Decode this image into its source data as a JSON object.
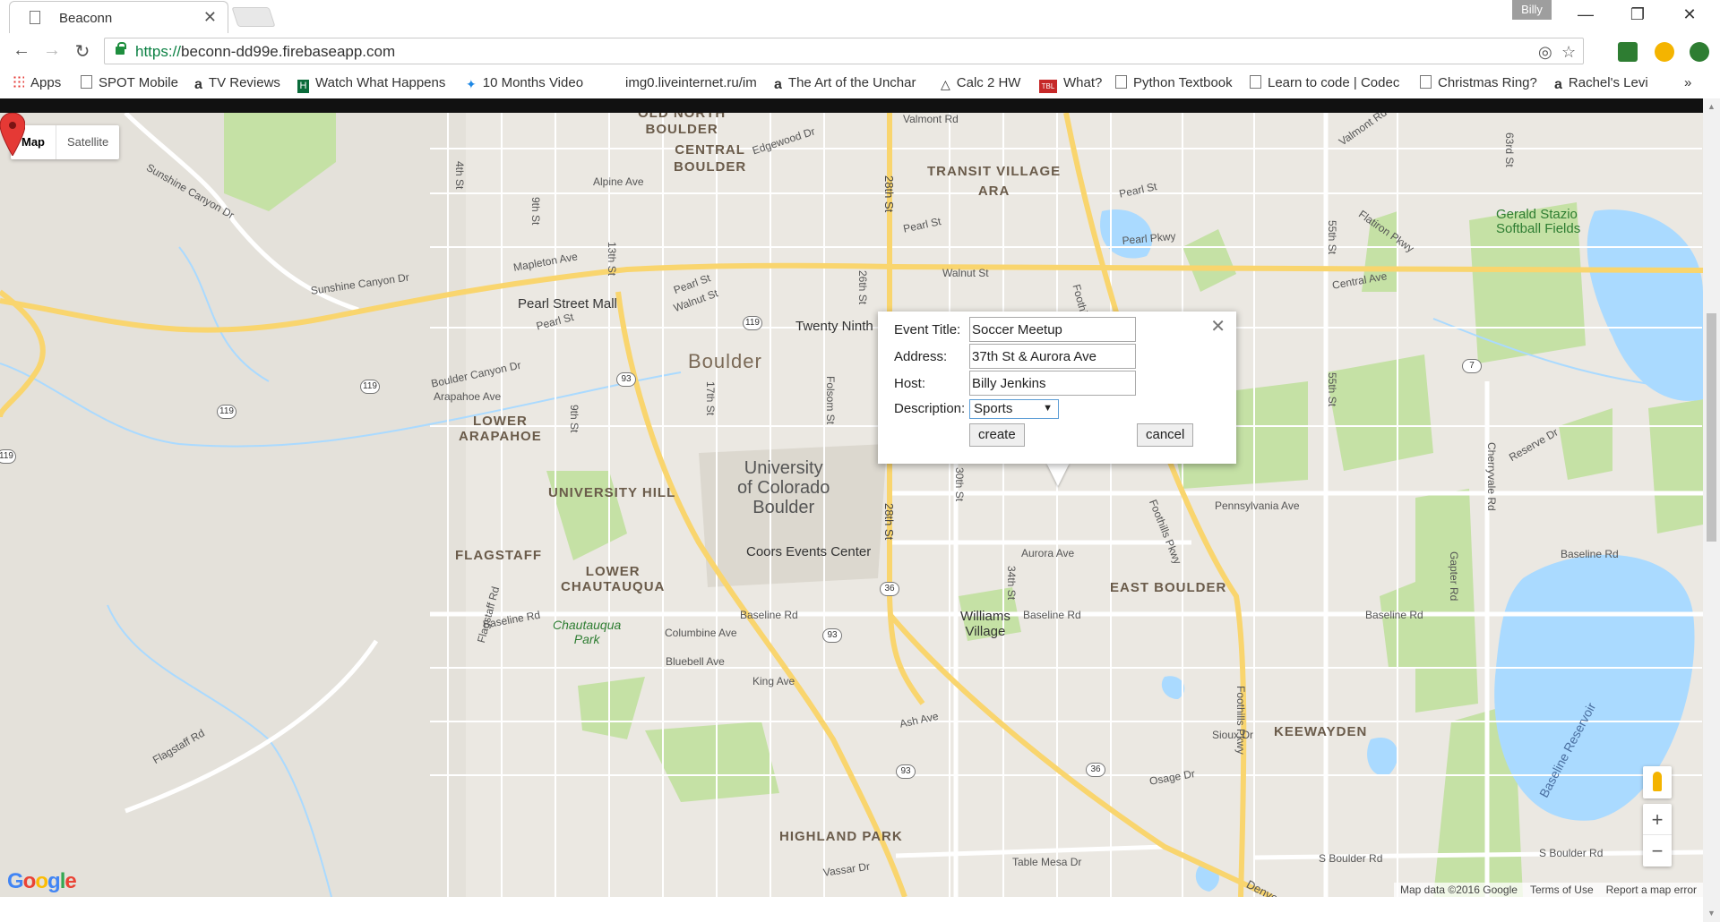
{
  "browser": {
    "tab_title": "Beaconn",
    "profile_name": "Billy",
    "url_scheme": "https://",
    "url_host": "beconn-dd99e.firebaseapp.com",
    "minimize_glyph": "—",
    "restore_glyph": "❐",
    "close_glyph": "✕",
    "back_glyph": "←",
    "forward_glyph": "→",
    "reload_glyph": "↻",
    "star_glyph": "☆",
    "target_glyph": "◎",
    "bookmarks_more": "»",
    "bookmarks": [
      {
        "label": "Apps",
        "icon": "apps-grid-icon"
      },
      {
        "label": "SPOT Mobile",
        "icon": "page-icon"
      },
      {
        "label": "TV Reviews",
        "icon": "amazon-icon"
      },
      {
        "label": "Watch What Happens",
        "icon": "h-icon"
      },
      {
        "label": "10 Months Video",
        "icon": "dropbox-icon"
      },
      {
        "label": "img0.liveinternet.ru/im",
        "icon": "none"
      },
      {
        "label": "The Art of the Unchar",
        "icon": "amazon-icon"
      },
      {
        "label": "Calc 2 HW",
        "icon": "calc-icon"
      },
      {
        "label": "What?",
        "icon": "tbl-icon"
      },
      {
        "label": "Python Textbook",
        "icon": "page-icon"
      },
      {
        "label": "Learn to code | Codec",
        "icon": "codecademy-icon"
      },
      {
        "label": "Christmas Ring?",
        "icon": "image-icon"
      },
      {
        "label": "Rachel's Levi",
        "icon": "amazon-icon"
      }
    ]
  },
  "map": {
    "type_map": "Map",
    "type_satellite": "Satellite",
    "google_logo": "Google",
    "attribution": [
      "Map data ©2016 Google",
      "Terms of Use",
      "Report a map error"
    ],
    "zoom_in": "+",
    "zoom_out": "−",
    "labels": {
      "central_boulder": "CENTRAL\nBOULDER",
      "old_north_boulder": "OLD NORTH\nBOULDER",
      "transit_village": "TRANSIT VILLAGE\nARA",
      "boulder": "Boulder",
      "lower_arapahoe": "LOWER\nARAPAHOE",
      "university_hill": "UNIVERSITY HILL",
      "flagstaff": "FLAGSTAFF",
      "lower_chautauqua": "LOWER\nCHAUTAUQUA",
      "chautauqua_park": "Chautauqua\nPark",
      "university": "University\nof Colorado\nBoulder",
      "coors": "Coors Events Center",
      "williams_village": "Williams\nVillage",
      "east_boulder": "EAST BOULDER",
      "keewayden": "KEEWAYDEN",
      "highland_park": "HIGHLAND PARK",
      "pearl_street_mall": "Pearl Street Mall",
      "twenty_ninth": "Twenty Ninth",
      "gerald_stazio": "Gerald Stazio\nSoftball Fields",
      "baseline_reservoir": "Baseline Reservoir",
      "valmont_rd": "Valmont Rd",
      "valmont_rd2": "Valmont Rd",
      "edgewood_dr": "Edgewood Dr",
      "alpine_ave": "Alpine Ave",
      "mapleton_ave": "Mapleton Ave",
      "pearl_st": "Pearl St",
      "pearl_st2": "Pearl St",
      "pearl_st3": "Pearl St",
      "walnut_st": "Walnut St",
      "walnut_st2": "Walnut St",
      "pearl_pkwy": "Pearl Pkwy",
      "central_ave": "Central Ave",
      "flatiron_pkwy": "Flatiron Pkwy",
      "boulder_canyon_dr": "Boulder Canyon Dr",
      "sunshine_canyon_dr": "Sunshine Canyon Dr",
      "sunshine_canyon_dr2": "Sunshine Canyon Dr",
      "arapahoe_ave": "Arapahoe Ave",
      "pennsylvania_ave": "Pennsylvania Ave",
      "aurora_ave": "Aurora Ave",
      "baseline_rd": "Baseline Rd",
      "baseline_rd2": "Baseline Rd",
      "baseline_rd3": "Baseline Rd",
      "baseline_rd4": "Baseline Rd",
      "baseline_rd5": "Baseline Rd",
      "columbine_ave": "Columbine Ave",
      "bluebell_ave": "Bluebell Ave",
      "king_ave": "King Ave",
      "ash_ave": "Ash Ave",
      "sioux_dr": "Sioux Dr",
      "osage_dr": "Osage Dr",
      "table_mesa_dr": "Table Mesa Dr",
      "vassar_dr": "Vassar Dr",
      "s_boulder_rd": "S Boulder Rd",
      "s_boulder_rd2": "S Boulder Rd",
      "flagstaff_rd": "Flagstaff Rd",
      "flagstaff_rd2": "Flagstaff Rd",
      "reserve_dr": "Reserve Dr",
      "st_28": "28th St",
      "st_28b": "28th St",
      "st_4": "4th St",
      "st_9": "9th St",
      "st_13": "13th St",
      "st_26": "26th St",
      "st_17": "17th St",
      "st_9b": "9th St",
      "st_30": "30th St",
      "st_34": "34th St",
      "st_55": "55th St",
      "st_55b": "55th St",
      "st_63": "63rd St",
      "folsom_st": "Folsom St",
      "foothills_pkwy": "Foothills Pkwy",
      "foothills_pkwy2": "Foothills Pkwy",
      "foothills_pkwy3": "Foothi",
      "cherryvale_rd": "Cherryvale Rd",
      "gapter_rd": "Gapter Rd",
      "denver": "Denve",
      "shield_119a": "119",
      "shield_119b": "119",
      "shield_119c": "119",
      "shield_119d": "119",
      "shield_93a": "93",
      "shield_93b": "93",
      "shield_93c": "93",
      "shield_36a": "36",
      "shield_36b": "36",
      "shield_7": "7"
    }
  },
  "info_window": {
    "close_glyph": "✕",
    "event_title_label": "Event Title:",
    "event_title_value": "Soccer Meetup",
    "address_label": "Address:",
    "address_value": "37th St & Aurora Ave",
    "host_label": "Host:",
    "host_value": "Billy Jenkins",
    "description_label": "Description:",
    "description_value": "Sports",
    "description_arrow": "▼",
    "create_label": "create",
    "cancel_label": "cancel"
  },
  "colors": {
    "map_bg": "#ebe8e2",
    "park": "#c5e1a5",
    "water": "#aadaff",
    "highway": "#f9d56e",
    "marker": "#e53935"
  }
}
